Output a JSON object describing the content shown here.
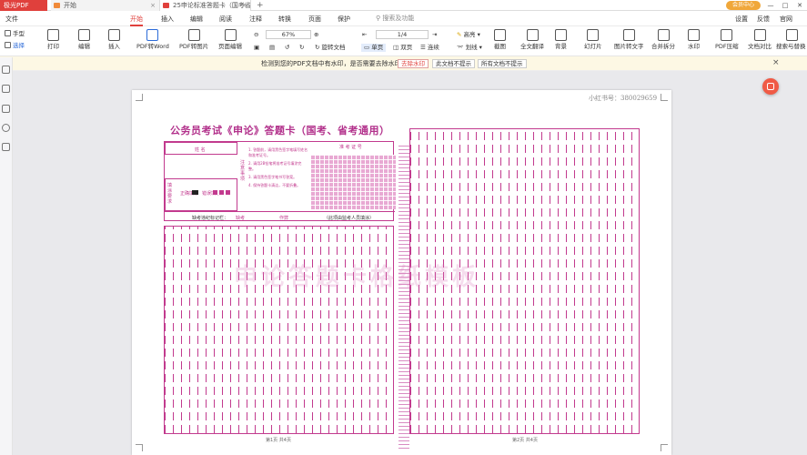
{
  "titlebar": {
    "app_name": "极光PDF",
    "tabs": [
      {
        "label": "开始",
        "close": "×"
      },
      {
        "label": "25申论标准答题卡（国考省...",
        "close": "×"
      }
    ],
    "new_tab": "+",
    "member_label": "会员中心"
  },
  "menubar": {
    "file_label": "文件",
    "items": [
      "开始",
      "插入",
      "编辑",
      "阅读",
      "注释",
      "转换",
      "页面",
      "保护"
    ],
    "search_placeholder": "搜索及功能",
    "right_items": [
      "设置",
      "反馈",
      "官网"
    ]
  },
  "toolbar": {
    "hand_label": "手型",
    "select_label": "选择",
    "buttons": [
      "打印",
      "编辑",
      "插入",
      "PDF转Word",
      "PDF转图片",
      "页面编辑"
    ],
    "zoom_value": "67%",
    "page_value": "1/4",
    "rotate_label": "旋转文档",
    "view_modes": [
      "单页",
      "双页",
      "连续"
    ],
    "highlight_label": "高亮",
    "strike_label": "划线",
    "tools": [
      "截图",
      "全文翻译",
      "背景",
      "幻灯片",
      "图片转文字",
      "合并拆分",
      "水印",
      "PDF压缩",
      "文档对比",
      "搜索与替换"
    ]
  },
  "notice": {
    "text": "检测到您的PDF文档中有水印，是否需要去除水印？",
    "btn_remove": "去除水印",
    "btn_no_doc": "此文档不提示",
    "btn_no_all": "所有文档不提示",
    "close": "×"
  },
  "document": {
    "serial": "小红书号：380029659",
    "title": "公务员考试《申论》答题卡（国考、省考通用）",
    "name_label": "姓  名",
    "exam_no_label": "准 考 证 号",
    "notice_label": "注意事项",
    "fill_label": "填涂要求",
    "correct_label": "正确填涂",
    "wrong_label": "错误填涂",
    "notes": [
      "1. 答题前，请用黑色签字笔填写姓名和准考证号。",
      "2. 请用2B铅笔将准考证号填涂完整。",
      "3. 请用黑色签字笔书写答案。",
      "4. 保持答题卡清洁，不要折叠。"
    ],
    "absent_label": "缺考违纪标记栏：",
    "absent_item": "缺考",
    "violation_item": "作弊",
    "proctor_note": "（此项由监考人员填涂）",
    "watermark": "申论答题卡格纸模板",
    "footer_left": "第1页  共4页",
    "footer_right": "第2页  共4页"
  }
}
